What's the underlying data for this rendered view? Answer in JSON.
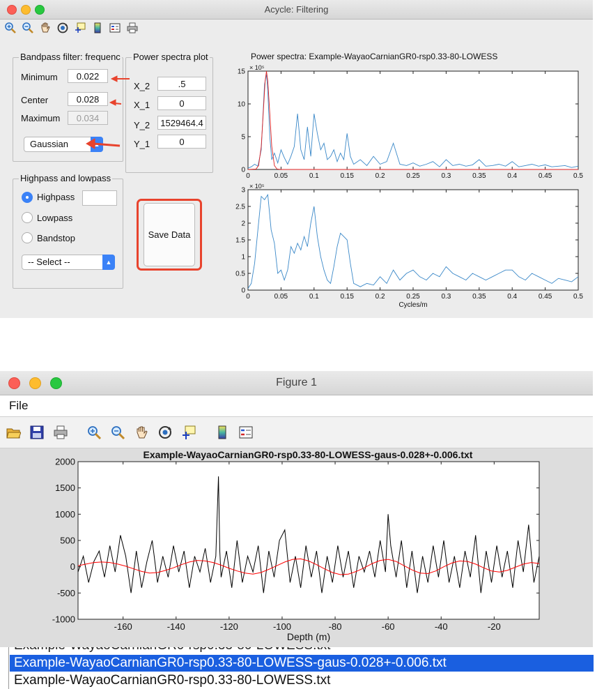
{
  "acycle": {
    "title": "Acycle: Filtering",
    "toolbar_icons": [
      "zoom-in-icon",
      "zoom-out-icon",
      "pan-hand-icon",
      "rotate-3d-icon",
      "data-cursor-icon",
      "colorbar-icon",
      "legend-icon",
      "print-icon"
    ],
    "bandpass": {
      "title": "Bandpass filter: frequenc",
      "min_label": "Minimum",
      "min_value": "0.022",
      "center_label": "Center",
      "center_value": "0.028",
      "max_label": "Maximum",
      "max_value": "0.034",
      "filter_type": "Gaussian"
    },
    "power_plot": {
      "title": "Power spectra plot",
      "x2_label": "X_2",
      "x2_value": ".5",
      "x1_label": "X_1",
      "x1_value": "0",
      "y2_label": "Y_2",
      "y2_value": "1529464.4",
      "y1_label": "Y_1",
      "y1_value": "0"
    },
    "highlow": {
      "title": "Highpass and lowpass",
      "options": [
        "Highpass",
        "Lowpass",
        "Bandstop"
      ],
      "selected": "Highpass",
      "select_placeholder": "-- Select --"
    },
    "save_label": "Save Data",
    "annotation_color": "#e8432d"
  },
  "figure": {
    "title": "Figure 1",
    "menu_file": "File",
    "toolbar_icons": [
      "open-icon",
      "save-icon",
      "print-icon",
      "zoom-in-icon",
      "zoom-out-icon",
      "pan-hand-icon",
      "rotate-3d-icon",
      "data-cursor-icon",
      "colorbar-icon",
      "legend-icon"
    ]
  },
  "file_list": {
    "selected": "Example-WayaoCarnianGR0-rsp0.33-80-LOWESS-gaus-0.028+-0.006.txt",
    "next": "Example-WayaoCarnianGR0-rsp0.33-80-LOWESS.txt",
    "selection_color": "#1a5fe0"
  },
  "chart_data": [
    {
      "type": "line",
      "title": "Power spectra:    Example-WayaoCarnianGR0-rsp0.33-80-LOWESS",
      "xlim": [
        0,
        0.5
      ],
      "ylim": [
        0,
        15
      ],
      "y_exponent": "× 10⁵",
      "xticks": [
        "0",
        "0.05",
        "0.1",
        "0.15",
        "0.2",
        "0.25",
        "0.3",
        "0.35",
        "0.4",
        "0.45",
        "0.5"
      ],
      "yticks": [
        "0",
        "5",
        "10",
        "15"
      ],
      "series": [
        {
          "color": "#3a88c8",
          "x": [
            0,
            0.005,
            0.01,
            0.015,
            0.02,
            0.025,
            0.028,
            0.03,
            0.033,
            0.036,
            0.04,
            0.045,
            0.05,
            0.055,
            0.06,
            0.065,
            0.07,
            0.075,
            0.08,
            0.085,
            0.09,
            0.095,
            0.1,
            0.105,
            0.11,
            0.115,
            0.12,
            0.125,
            0.13,
            0.135,
            0.14,
            0.145,
            0.15,
            0.155,
            0.16,
            0.17,
            0.18,
            0.19,
            0.2,
            0.21,
            0.22,
            0.23,
            0.24,
            0.25,
            0.26,
            0.27,
            0.28,
            0.29,
            0.3,
            0.31,
            0.32,
            0.33,
            0.34,
            0.35,
            0.36,
            0.37,
            0.38,
            0.39,
            0.4,
            0.41,
            0.42,
            0.43,
            0.44,
            0.45,
            0.46,
            0.47,
            0.48,
            0.49,
            0.5
          ],
          "y": [
            0.2,
            0.4,
            0.8,
            0.5,
            3,
            13,
            14.5,
            12,
            5,
            1.5,
            2.5,
            1,
            3,
            1.8,
            0.8,
            2,
            3.5,
            8.5,
            3,
            1.5,
            6.5,
            2,
            8.5,
            5.5,
            3,
            4,
            1.5,
            2,
            3,
            1.2,
            2.5,
            1.5,
            5.5,
            2,
            0.8,
            1.5,
            0.6,
            2,
            0.8,
            1.2,
            4,
            0.8,
            0.6,
            1,
            0.5,
            0.8,
            1.2,
            0.4,
            1.5,
            0.6,
            0.8,
            0.5,
            0.7,
            1.5,
            0.5,
            0.6,
            0.8,
            0.5,
            1.2,
            0.4,
            0.6,
            0.8,
            0.5,
            0.7,
            0.4,
            0.5,
            0.6,
            0.3,
            0.5
          ]
        },
        {
          "color": "#e02020",
          "x": [
            0,
            0.012,
            0.016,
            0.02,
            0.023,
            0.026,
            0.028,
            0.03,
            0.033,
            0.036,
            0.04,
            0.044,
            0.05,
            0.1,
            0.2,
            0.3,
            0.4,
            0.5
          ],
          "y": [
            0,
            0.05,
            0.6,
            3.5,
            8.5,
            13.5,
            15.2,
            13.5,
            8.5,
            3.5,
            0.6,
            0.05,
            0,
            0,
            0,
            0,
            0,
            0
          ]
        }
      ]
    },
    {
      "type": "line",
      "xlabel": "Cycles/m",
      "xlim": [
        0,
        0.5
      ],
      "ylim": [
        0,
        3
      ],
      "y_exponent": "× 10⁵",
      "xticks": [
        "0",
        "0.05",
        "0.1",
        "0.15",
        "0.2",
        "0.25",
        "0.3",
        "0.35",
        "0.4",
        "0.45",
        "0.5"
      ],
      "yticks": [
        "0",
        "0.5",
        "1",
        "1.5",
        "2",
        "2.5",
        "3"
      ],
      "series": [
        {
          "color": "#3a88c8",
          "x": [
            0,
            0.005,
            0.01,
            0.015,
            0.02,
            0.025,
            0.03,
            0.035,
            0.04,
            0.045,
            0.05,
            0.055,
            0.06,
            0.065,
            0.07,
            0.075,
            0.08,
            0.085,
            0.09,
            0.095,
            0.1,
            0.105,
            0.11,
            0.115,
            0.12,
            0.125,
            0.13,
            0.135,
            0.14,
            0.145,
            0.15,
            0.155,
            0.16,
            0.17,
            0.18,
            0.19,
            0.2,
            0.21,
            0.22,
            0.23,
            0.24,
            0.25,
            0.26,
            0.27,
            0.28,
            0.29,
            0.3,
            0.31,
            0.32,
            0.33,
            0.34,
            0.35,
            0.36,
            0.37,
            0.38,
            0.39,
            0.4,
            0.41,
            0.42,
            0.43,
            0.44,
            0.45,
            0.46,
            0.47,
            0.48,
            0.49,
            0.5
          ],
          "y": [
            0.05,
            0.2,
            0.8,
            1.8,
            2.8,
            2.7,
            2.85,
            1.8,
            1.4,
            0.5,
            0.6,
            0.3,
            0.6,
            1.3,
            1.1,
            1.4,
            1.2,
            1.6,
            1.3,
            2.0,
            2.5,
            1.6,
            1.0,
            0.6,
            0.3,
            0.2,
            0.7,
            1.3,
            1.7,
            1.6,
            1.5,
            0.8,
            0.2,
            0.1,
            0.2,
            0.15,
            0.4,
            0.2,
            0.6,
            0.3,
            0.5,
            0.6,
            0.4,
            0.3,
            0.5,
            0.4,
            0.7,
            0.5,
            0.4,
            0.3,
            0.5,
            0.4,
            0.3,
            0.4,
            0.5,
            0.6,
            0.6,
            0.4,
            0.3,
            0.5,
            0.4,
            0.3,
            0.2,
            0.35,
            0.3,
            0.25,
            0.4
          ]
        }
      ]
    },
    {
      "type": "line",
      "title": "Example-WayaoCarnianGR0-rsp0.33-80-LOWESS-gaus-0.028+-0.006.txt",
      "xlabel": "Depth (m)",
      "xlim": [
        -177,
        -3
      ],
      "ylim": [
        -1000,
        2000
      ],
      "xticks": [
        -160,
        -140,
        -120,
        -100,
        -80,
        -60,
        -40,
        -20
      ],
      "yticks": [
        -1000,
        -500,
        0,
        500,
        1000,
        1500,
        2000
      ],
      "series": [
        {
          "color": "#000000",
          "x": [
            -177,
            -175,
            -173,
            -171,
            -169,
            -167,
            -165,
            -163,
            -161,
            -159,
            -157,
            -155,
            -153,
            -151,
            -149,
            -147,
            -145,
            -143,
            -141,
            -139,
            -137,
            -135,
            -133,
            -131,
            -129,
            -127,
            -125,
            -124,
            -123.5,
            -123,
            -121,
            -119,
            -117,
            -115,
            -113,
            -111,
            -109,
            -107,
            -105,
            -103,
            -101,
            -99,
            -97,
            -95,
            -93,
            -91,
            -89,
            -87,
            -85,
            -83,
            -81,
            -79,
            -77,
            -75,
            -73,
            -71,
            -69,
            -67,
            -65,
            -63,
            -61,
            -60,
            -59,
            -57,
            -55,
            -53,
            -51,
            -49,
            -47,
            -45,
            -43,
            -41,
            -39,
            -37,
            -35,
            -33,
            -31,
            -29,
            -27,
            -25,
            -23,
            -21,
            -19,
            -17,
            -15,
            -13,
            -11,
            -9,
            -7,
            -5,
            -3
          ],
          "y": [
            -100,
            200,
            -300,
            100,
            300,
            -200,
            400,
            -100,
            600,
            200,
            -500,
            300,
            -400,
            100,
            500,
            -300,
            200,
            -200,
            400,
            -100,
            300,
            -400,
            200,
            -100,
            350,
            -300,
            200,
            1720,
            300,
            -200,
            300,
            -400,
            500,
            -300,
            200,
            -100,
            400,
            -500,
            300,
            -200,
            500,
            700,
            -300,
            200,
            -400,
            400,
            -200,
            300,
            -500,
            200,
            -300,
            400,
            -200,
            300,
            -400,
            200,
            -100,
            300,
            -200,
            500,
            -100,
            1000,
            400,
            -200,
            500,
            -400,
            300,
            -500,
            200,
            -300,
            400,
            -200,
            500,
            -300,
            200,
            -400,
            300,
            -200,
            600,
            -500,
            300,
            -300,
            400,
            -200,
            300,
            -400,
            500,
            -100,
            800,
            -300,
            200
          ]
        },
        {
          "color": "#ff0000",
          "x": [
            -177,
            -174,
            -171,
            -168,
            -165,
            -162,
            -159,
            -156,
            -153,
            -150,
            -147,
            -144,
            -141,
            -138,
            -135,
            -132,
            -129,
            -126,
            -123,
            -120,
            -117,
            -114,
            -111,
            -108,
            -105,
            -102,
            -99,
            -96,
            -93,
            -90,
            -87,
            -84,
            -81,
            -78,
            -75,
            -72,
            -69,
            -66,
            -63,
            -60,
            -57,
            -54,
            -51,
            -48,
            -45,
            -42,
            -39,
            -36,
            -33,
            -30,
            -27,
            -24,
            -21,
            -18,
            -15,
            -12,
            -9,
            -6,
            -3
          ],
          "y": [
            20,
            50,
            80,
            90,
            80,
            50,
            10,
            -40,
            -90,
            -120,
            -110,
            -70,
            -20,
            40,
            90,
            120,
            110,
            80,
            30,
            -30,
            -80,
            -120,
            -140,
            -110,
            -50,
            20,
            90,
            140,
            150,
            110,
            40,
            -40,
            -110,
            -150,
            -140,
            -90,
            -20,
            60,
            120,
            140,
            100,
            20,
            -60,
            -120,
            -130,
            -80,
            0,
            70,
            110,
            100,
            50,
            -20,
            -80,
            -100,
            -70,
            -10,
            50,
            80,
            60
          ]
        }
      ]
    }
  ]
}
